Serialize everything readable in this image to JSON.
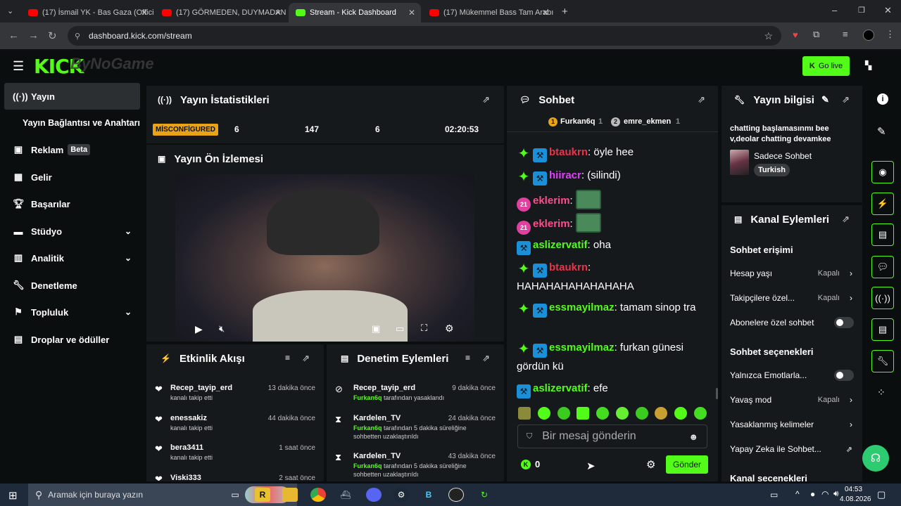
{
  "browser": {
    "tabs": [
      {
        "label": "(17) İsmail YK - Bas Gaza (Offici"
      },
      {
        "label": "(17) GÖRMEDEN, DUYMADAN"
      },
      {
        "label": "Stream - Kick Dashboard"
      },
      {
        "label": "(17) Mükemmel Bass Tam Arabı"
      }
    ],
    "url": "dashboard.kick.com/stream"
  },
  "header": {
    "logo": "KICK",
    "logo_overlay": "ByNoGame",
    "go_live": "Go live"
  },
  "sidebar": {
    "items": [
      {
        "label": "Yayın"
      },
      {
        "label": "Yayın Bağlantısı ve Anahtarı"
      },
      {
        "label": "Reklam",
        "badge": "Beta"
      },
      {
        "label": "Gelir"
      },
      {
        "label": "Başarılar"
      },
      {
        "label": "Stüdyo"
      },
      {
        "label": "Analitik"
      },
      {
        "label": "Denetleme"
      },
      {
        "label": "Topluluk"
      },
      {
        "label": "Droplar ve ödüller"
      }
    ]
  },
  "stats": {
    "title": "Yayın İstatistikleri",
    "status": "MİSCONFİGURED",
    "v1": "6",
    "v2": "147",
    "v3": "6",
    "time": "02:20:53"
  },
  "preview": {
    "title": "Yayın Ön İzlemesi"
  },
  "activity": {
    "title": "Etkinlik Akışı",
    "items": [
      {
        "name": "Recep_tayip_erd",
        "sub": "kanalı takip etti",
        "time": "13 dakika önce"
      },
      {
        "name": "enessakiz",
        "sub": "kanalı takip etti",
        "time": "44 dakika önce"
      },
      {
        "name": "bera3411",
        "sub": "kanalı takip etti",
        "time": "1 saat önce"
      },
      {
        "name": "Viski333",
        "sub": "",
        "time": "2 saat önce"
      }
    ]
  },
  "moderation": {
    "title": "Denetim Eylemleri",
    "items": [
      {
        "name": "Recep_tayip_erd",
        "actor": "Furkan6q",
        "sub": " tarafından yasaklandı",
        "sub2": "",
        "time": "9 dakika önce"
      },
      {
        "name": "Kardelen_TV",
        "actor": "Furkan6q",
        "sub": " tarafından 5 dakika süreliğine",
        "sub2": "sohbetten uzaklaştırıldı",
        "time": "24 dakika önce"
      },
      {
        "name": "Kardelen_TV",
        "actor": "Furkan6q",
        "sub": " tarafından 5 dakika süreliğine",
        "sub2": "sohbetten uzaklaştırıldı",
        "time": "43 dakika önce"
      }
    ]
  },
  "chat": {
    "title": "Sohbet",
    "pinned": [
      {
        "name": "Furkan6q",
        "count": "1",
        "rank": "1"
      },
      {
        "name": "emre_ekmen",
        "count": "1",
        "rank": "2"
      }
    ],
    "messages": [
      {
        "user": "btaukrn",
        "text": "öyle hee",
        "color": "#e8344b"
      },
      {
        "user": "hiiracr",
        "text": "(silindi)",
        "color": "#e040fb"
      },
      {
        "user": "eklerim",
        "text": "",
        "color": "#ff4d8a"
      },
      {
        "user": "eklerim",
        "text": "",
        "color": "#ff4d8a"
      },
      {
        "user": "aslizervatif",
        "text": "oha",
        "color": "#53fc18"
      },
      {
        "user": "btaukrn",
        "text": "HAHAHAHAHAHAHAHA",
        "color": "#e8344b"
      },
      {
        "user": "essmayilmaz",
        "text": "tamam sinop tra",
        "color": "#53fc18"
      },
      {
        "user": "essmayilmaz",
        "text": "furkan günesi gördün kü",
        "color": "#53fc18"
      },
      {
        "user": "aslizervatif",
        "text": "efe",
        "color": "#53fc18"
      }
    ],
    "sub_badge": "21",
    "placeholder": "Bir mesaj gönderin",
    "points": "0",
    "send": "Gönder"
  },
  "streaminfo": {
    "title": "Yayın bilgisi",
    "desc": "chatting başlamasınmı bee v,deolar chatting devamkee",
    "category": "Sadece Sohbet",
    "language": "Turkish"
  },
  "channel": {
    "title": "Kanal Eylemleri",
    "section1": "Sohbet erişimi",
    "section2": "Sohbet seçenekleri",
    "section3": "Kanal seçenekleri",
    "rows": [
      {
        "label": "Hesap yaşı",
        "value": "Kapalı"
      },
      {
        "label": "Takipçilere özel...",
        "value": "Kapalı"
      },
      {
        "label": "Abonelere özel sohbet",
        "value": ""
      },
      {
        "label": "Yalnızca Emotlarla...",
        "value": ""
      },
      {
        "label": "Yavaş mod",
        "value": "Kapalı"
      },
      {
        "label": "Yasaklanmış kelimeler",
        "value": ""
      },
      {
        "label": "Yapay Zeka ile Sohbet...",
        "value": ""
      }
    ]
  },
  "taskbar": {
    "search": "Aramak için buraya yazın",
    "time": "04:53",
    "date": "4.08.2026"
  },
  "colors": {
    "accent": "#53fc18",
    "panel": "#16191b",
    "bg": "#0b0e0f"
  }
}
